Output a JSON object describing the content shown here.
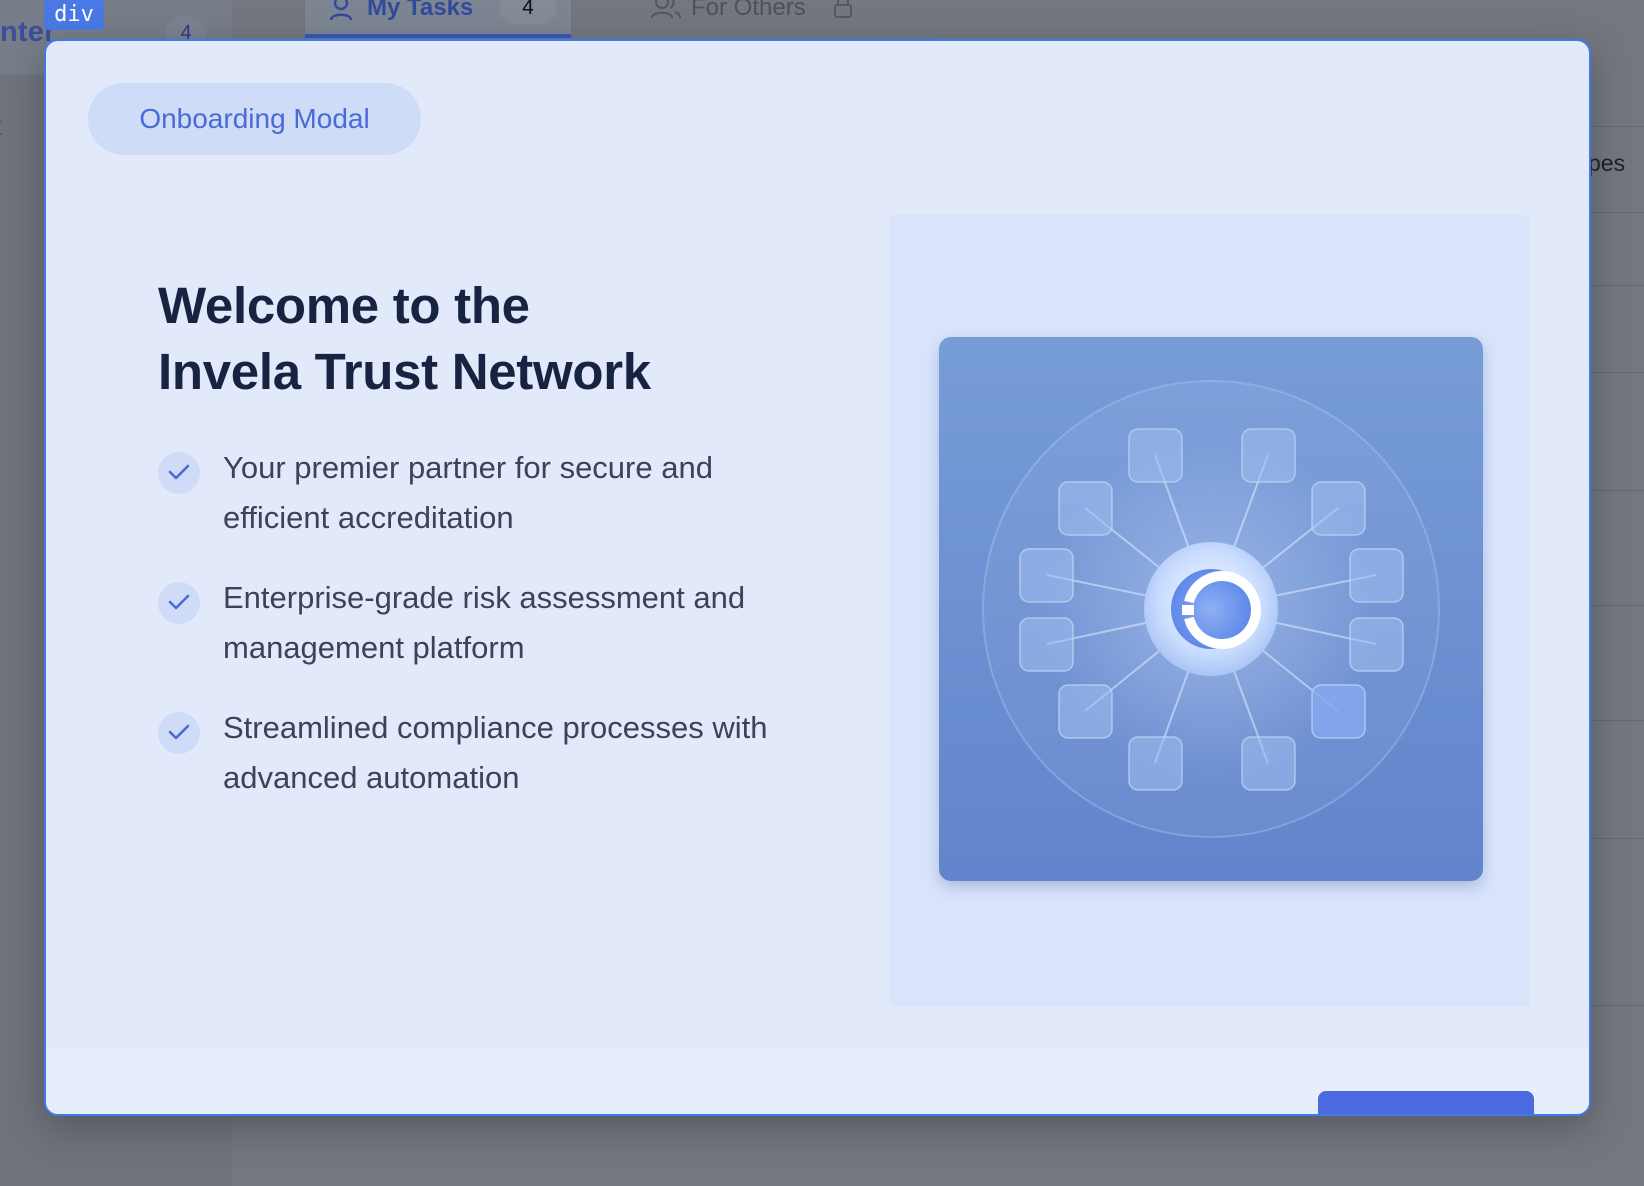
{
  "background": {
    "sidebar": {
      "label": "nter",
      "count": "4",
      "partial_text": "t"
    },
    "inspector_tag": "div",
    "tabs": [
      {
        "label": "My Tasks",
        "count": "4"
      },
      {
        "label": "For Others"
      }
    ],
    "right_partial_text": "pes"
  },
  "modal": {
    "pill_label": "Onboarding Modal",
    "title_line1": "Welcome to the",
    "title_line2": "Invela Trust Network",
    "features": [
      {
        "line1": "Your premier partner for secure and",
        "line2": "efficient accreditation"
      },
      {
        "line1": "Enterprise-grade risk assessment and",
        "line2": "management platform"
      },
      {
        "line1": "Streamlined compliance processes with",
        "line2": "advanced automation"
      }
    ],
    "icons": {
      "feature": "check-icon",
      "illustration_center": "refresh-icon"
    },
    "colors": {
      "accent": "#4b6ae0",
      "modal_border": "#3f7be6",
      "heading": "#172340"
    }
  }
}
